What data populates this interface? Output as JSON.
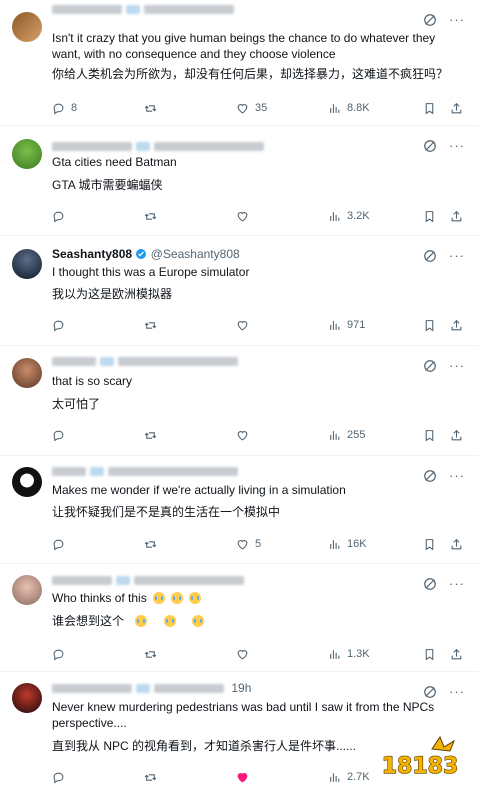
{
  "tweets": [
    {
      "name": "",
      "handle": "",
      "time": "",
      "lines": [
        "Isn't it crazy that you give human beings the chance to do whatever they want, with no consequence and they choose violence",
        "你给人类机会为所欲为，却没有任何后果，却选择暴力，这难道不疯狂吗？"
      ],
      "stats": {
        "replies": "8",
        "reposts": "",
        "likes": "35",
        "views": "8.8K"
      },
      "liked": false
    },
    {
      "name": "",
      "handle": "",
      "time": "",
      "lines": [
        "Gta cities need Batman",
        "GTA 城市需要蝙蝠侠"
      ],
      "stats": {
        "replies": "",
        "reposts": "",
        "likes": "",
        "views": "3.2K"
      },
      "liked": false
    },
    {
      "name": "Seashanty808",
      "handle": "@Seashanty808",
      "time": "",
      "lines": [
        "I thought this was a Europe simulator",
        "我以为这是欧洲模拟器"
      ],
      "stats": {
        "replies": "",
        "reposts": "",
        "likes": "",
        "views": "971"
      },
      "liked": false
    },
    {
      "name": "",
      "handle": "",
      "time": "",
      "lines": [
        "that is so scary",
        "太可怕了"
      ],
      "stats": {
        "replies": "",
        "reposts": "",
        "likes": "",
        "views": "255"
      },
      "liked": false
    },
    {
      "name": "",
      "handle": "",
      "time": "",
      "lines": [
        "Makes me wonder if we're actually living in a simulation",
        "让我怀疑我们是不是真的生活在一个模拟中"
      ],
      "stats": {
        "replies": "",
        "reposts": "",
        "likes": "5",
        "views": "16K"
      },
      "liked": false
    },
    {
      "name": "",
      "handle": "",
      "time": "",
      "lines": [
        "Who thinks of this",
        "谁会想到这个"
      ],
      "emoji": "loudly-crying-face",
      "stats": {
        "replies": "",
        "reposts": "",
        "likes": "",
        "views": "1.3K"
      },
      "liked": false
    },
    {
      "name": "",
      "handle": "",
      "time": "19h",
      "lines": [
        "Never knew murdering pedestrians was bad until I saw it from the NPCs perspective....",
        "直到我从 NPC 的视角看到，才知道杀害行人是件坏事......"
      ],
      "stats": {
        "replies": "",
        "reposts": "",
        "likes": "",
        "views": "2.7K"
      },
      "liked": true
    }
  ],
  "watermark": {
    "text": "18183"
  },
  "colors": {
    "text": "#0f1419",
    "muted": "#536471",
    "divider": "#eff3f4",
    "verified": "#1d9bf0",
    "like": "#f91880"
  }
}
